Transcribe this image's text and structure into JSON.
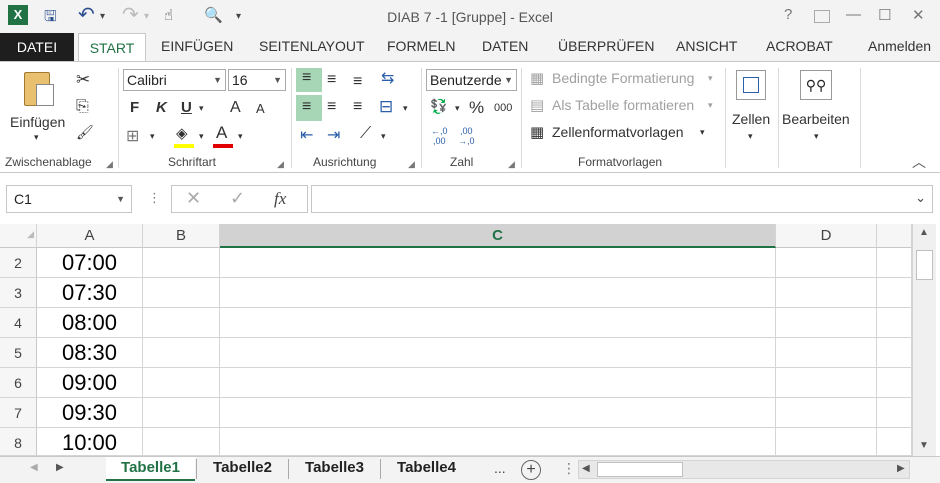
{
  "window": {
    "title": "DIAB 7 -1  [Gruppe] - Excel",
    "login": "Anmelden",
    "help": "?",
    "minimize": "—",
    "restore": "☐",
    "close": "✕"
  },
  "qat": {
    "excel_logo": "X",
    "save": "🖫",
    "undo": "↶",
    "redo": "↷",
    "touch": "☝",
    "preview": "🔍",
    "more": "▾"
  },
  "tabs": [
    "DATEI",
    "START",
    "EINFÜGEN",
    "SEITENLAYOUT",
    "FORMELN",
    "DATEN",
    "ÜBERPRÜFEN",
    "ANSICHT",
    "ACROBAT"
  ],
  "ribbon": {
    "clipboard": {
      "group": "Zwischenablage",
      "paste": "Einfügen",
      "cut": "✂",
      "copy": "⎘",
      "painter": "🖌"
    },
    "font": {
      "group": "Schriftart",
      "name": "Calibri",
      "size": "16",
      "bold": "F",
      "italic": "K",
      "underline": "U",
      "grow": "A",
      "shrink": "A",
      "border": "⊞",
      "fill": "◈",
      "color": "A"
    },
    "align": {
      "group": "Ausrichtung",
      "top": "≡",
      "middle": "≡",
      "bottom": "≡",
      "wrap": "⇆",
      "left": "≡",
      "center": "≡",
      "right": "≡",
      "merge": "⊟",
      "indent_dec": "⇤",
      "indent_inc": "⇥",
      "orient": "⟋"
    },
    "number": {
      "group": "Zahl",
      "format": "Benutzerde",
      "currency": "💱",
      "percent": "%",
      "thousands": "000",
      "dec_inc": "←,0\n,00",
      "dec_dec": ",00\n→,0"
    },
    "styles": {
      "group": "Formatvorlagen",
      "conditional": "Bedingte Formatierung",
      "table": "Als Tabelle formatieren",
      "cell_styles": "Zellenformatvorlagen"
    },
    "cells": {
      "label": "Zellen"
    },
    "edit": {
      "label": "Bearbeiten"
    },
    "collapse": "︿"
  },
  "formula": {
    "namebox": "C1",
    "cancel": "✕",
    "enter": "✓",
    "fx": "fx",
    "value": ""
  },
  "columns": [
    "A",
    "B",
    "C",
    "D"
  ],
  "rows": [
    {
      "num": "2",
      "a": "07:00"
    },
    {
      "num": "3",
      "a": "07:30"
    },
    {
      "num": "4",
      "a": "08:00"
    },
    {
      "num": "5",
      "a": "08:30"
    },
    {
      "num": "6",
      "a": "09:00"
    },
    {
      "num": "7",
      "a": "09:30"
    },
    {
      "num": "8",
      "a": "10:00"
    }
  ],
  "sheets": [
    "Tabelle1",
    "Tabelle2",
    "Tabelle3",
    "Tabelle4"
  ],
  "sheet_more": "...",
  "sheet_add": "+",
  "accent": "#217346"
}
